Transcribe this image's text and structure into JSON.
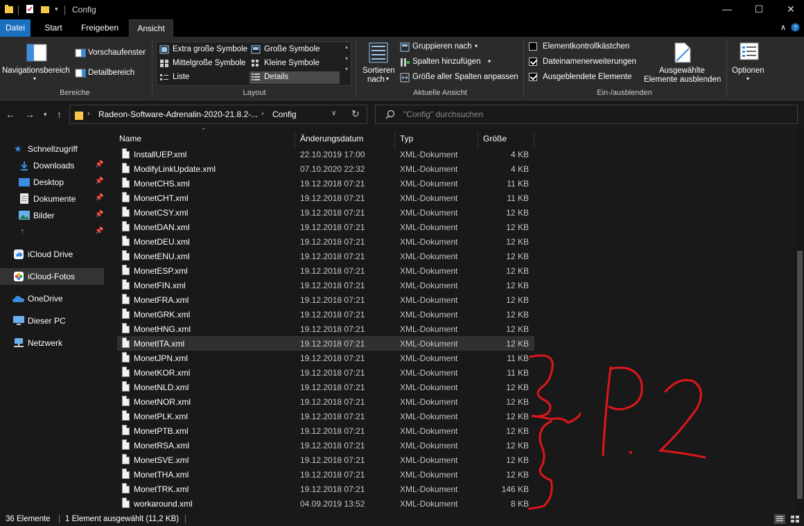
{
  "window": {
    "title": "Config"
  },
  "tabs": [
    {
      "label": "Datei"
    },
    {
      "label": "Start"
    },
    {
      "label": "Freigeben"
    },
    {
      "label": "Ansicht"
    }
  ],
  "ribbon": {
    "bereiche": {
      "nav_pane": "Navigationsbereich",
      "preview": "Vorschaufenster",
      "details": "Detailbereich",
      "label": "Bereiche"
    },
    "layout": {
      "items": [
        "Extra große Symbole",
        "Große Symbole",
        "Mittelgroße Symbole",
        "Kleine Symbole",
        "Liste",
        "Details"
      ],
      "label": "Layout"
    },
    "current_view": {
      "sort_line1": "Sortieren",
      "sort_line2": "nach",
      "group": "Gruppieren nach",
      "add_columns": "Spalten hinzufügen",
      "fit_columns": "Größe aller Spalten anpassen",
      "label": "Aktuelle Ansicht"
    },
    "show_hide": {
      "item_checkboxes": "Elementkontrollkästchen",
      "file_extensions": "Dateinamenerweiterungen",
      "hidden_items": "Ausgeblendete Elemente",
      "hide_selected_line1": "Ausgewählte",
      "hide_selected_line2": "Elemente ausblenden",
      "label": "Ein-/ausblenden"
    },
    "options": {
      "label": "Optionen"
    }
  },
  "address": {
    "segments": [
      "Radeon-Software-Adrenalin-2020-21.8.2-...",
      "Config"
    ],
    "search_placeholder": "\"Config\" durchsuchen"
  },
  "sidebar": {
    "quick_access": "Schnellzugriff",
    "quick_items": [
      {
        "label": "Downloads"
      },
      {
        "label": "Desktop"
      },
      {
        "label": "Dokumente"
      },
      {
        "label": "Bilder"
      }
    ],
    "locations": [
      {
        "label": "iCloud Drive"
      },
      {
        "label": "iCloud-Fotos"
      },
      {
        "label": "OneDrive"
      },
      {
        "label": "Dieser PC"
      },
      {
        "label": "Netzwerk"
      }
    ]
  },
  "columns": {
    "name": "Name",
    "date": "Änderungsdatum",
    "type": "Typ",
    "size": "Größe"
  },
  "files": [
    {
      "name": "InstallUEP.xml",
      "date": "22.10.2019 17:00",
      "type": "XML-Dokument",
      "size": "4 KB"
    },
    {
      "name": "ModifyLinkUpdate.xml",
      "date": "07.10.2020 22:32",
      "type": "XML-Dokument",
      "size": "4 KB"
    },
    {
      "name": "MonetCHS.xml",
      "date": "19.12.2018 07:21",
      "type": "XML-Dokument",
      "size": "11 KB"
    },
    {
      "name": "MonetCHT.xml",
      "date": "19.12.2018 07:21",
      "type": "XML-Dokument",
      "size": "11 KB"
    },
    {
      "name": "MonetCSY.xml",
      "date": "19.12.2018 07:21",
      "type": "XML-Dokument",
      "size": "12 KB"
    },
    {
      "name": "MonetDAN.xml",
      "date": "19.12.2018 07:21",
      "type": "XML-Dokument",
      "size": "12 KB"
    },
    {
      "name": "MonetDEU.xml",
      "date": "19.12.2018 07:21",
      "type": "XML-Dokument",
      "size": "12 KB"
    },
    {
      "name": "MonetENU.xml",
      "date": "19.12.2018 07:21",
      "type": "XML-Dokument",
      "size": "12 KB"
    },
    {
      "name": "MonetESP.xml",
      "date": "19.12.2018 07:21",
      "type": "XML-Dokument",
      "size": "12 KB"
    },
    {
      "name": "MonetFIN.xml",
      "date": "19.12.2018 07:21",
      "type": "XML-Dokument",
      "size": "12 KB"
    },
    {
      "name": "MonetFRA.xml",
      "date": "19.12.2018 07:21",
      "type": "XML-Dokument",
      "size": "12 KB"
    },
    {
      "name": "MonetGRK.xml",
      "date": "19.12.2018 07:21",
      "type": "XML-Dokument",
      "size": "12 KB"
    },
    {
      "name": "MonetHNG.xml",
      "date": "19.12.2018 07:21",
      "type": "XML-Dokument",
      "size": "12 KB"
    },
    {
      "name": "MonetITA.xml",
      "date": "19.12.2018 07:21",
      "type": "XML-Dokument",
      "size": "12 KB"
    },
    {
      "name": "MonetJPN.xml",
      "date": "19.12.2018 07:21",
      "type": "XML-Dokument",
      "size": "11 KB"
    },
    {
      "name": "MonetKOR.xml",
      "date": "19.12.2018 07:21",
      "type": "XML-Dokument",
      "size": "11 KB"
    },
    {
      "name": "MonetNLD.xml",
      "date": "19.12.2018 07:21",
      "type": "XML-Dokument",
      "size": "12 KB"
    },
    {
      "name": "MonetNOR.xml",
      "date": "19.12.2018 07:21",
      "type": "XML-Dokument",
      "size": "12 KB"
    },
    {
      "name": "MonetPLK.xml",
      "date": "19.12.2018 07:21",
      "type": "XML-Dokument",
      "size": "12 KB"
    },
    {
      "name": "MonetPTB.xml",
      "date": "19.12.2018 07:21",
      "type": "XML-Dokument",
      "size": "12 KB"
    },
    {
      "name": "MonetRSA.xml",
      "date": "19.12.2018 07:21",
      "type": "XML-Dokument",
      "size": "12 KB"
    },
    {
      "name": "MonetSVE.xml",
      "date": "19.12.2018 07:21",
      "type": "XML-Dokument",
      "size": "12 KB"
    },
    {
      "name": "MonetTHA.xml",
      "date": "19.12.2018 07:21",
      "type": "XML-Dokument",
      "size": "12 KB"
    },
    {
      "name": "MonetTRK.xml",
      "date": "19.12.2018 07:21",
      "type": "XML-Dokument",
      "size": "146 KB"
    },
    {
      "name": "workaround.xml",
      "date": "04.09.2019 13:52",
      "type": "XML-Dokument",
      "size": "8 KB"
    }
  ],
  "status": {
    "count": "36 Elemente",
    "selection": "1 Element ausgewählt (11,2 KB)"
  },
  "colors": {
    "accent": "#1a6fbf",
    "annotation": "#e0161b"
  }
}
